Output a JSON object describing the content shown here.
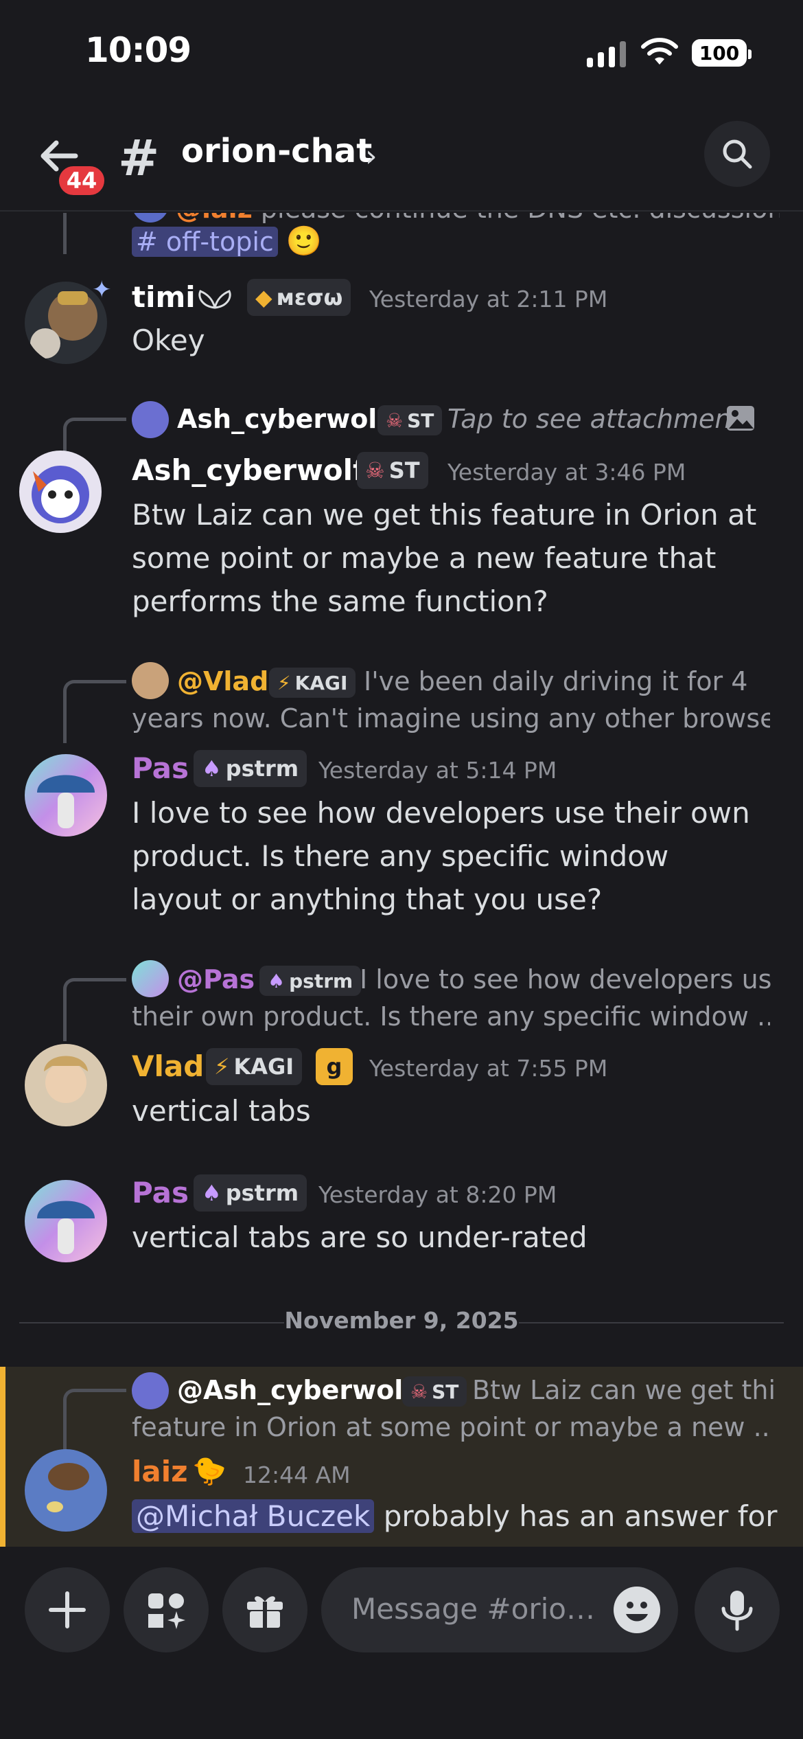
{
  "status_bar": {
    "time": "10:09",
    "battery": "100"
  },
  "header": {
    "unread_badge": "44",
    "channel_hash": "#",
    "channel_name": "orion-chat",
    "chevron": "›"
  },
  "messages": {
    "clip_top": {
      "reply_name": "@laiz",
      "reply_text": "please continue the DNS etc. discussion in",
      "channel_link": "# off-topic",
      "emoji": "🙂"
    },
    "m1": {
      "username": "timi",
      "tag": "мεσω",
      "timestamp": "Yesterday at 2:11 PM",
      "body": "Okey"
    },
    "m2": {
      "reply_name": "Ash_cyberwolf",
      "reply_tag": "ST",
      "reply_text": "Tap to see attachment",
      "username": "Ash_cyberwolf",
      "tag": "ST",
      "timestamp": "Yesterday at 3:46 PM",
      "body": "Btw Laiz can we get this feature in Orion at some point or maybe a new feature that performs the same function?"
    },
    "m3": {
      "reply_name": "@Vlad",
      "reply_tag": "KAGI",
      "reply_text_1": "I've been daily driving it for 4",
      "reply_text_2": "years now. Can't imagine using any other browser. ...",
      "username": "Pas",
      "tag": "pstrm",
      "timestamp": "Yesterday at 5:14 PM",
      "body": "I love to see how developers use their own product. Is there any specific window layout or anything that you use?"
    },
    "m4": {
      "reply_name": "@Pas",
      "reply_tag": "pstrm",
      "reply_text_1": "I love to see how developers use",
      "reply_text_2": "their own product. Is there any specific window ...",
      "username": "Vlad",
      "tag": "KAGI",
      "tag2": "g",
      "timestamp": "Yesterday at 7:55 PM",
      "body": "vertical tabs"
    },
    "m5": {
      "username": "Pas",
      "tag": "pstrm",
      "timestamp": "Yesterday at 8:20 PM",
      "body": "vertical tabs are so under-rated"
    },
    "date_divider": "November 9, 2025",
    "m6": {
      "reply_name": "@Ash_cyberwolf",
      "reply_tag": "ST",
      "reply_text_1": "Btw Laiz can we get this",
      "reply_text_2": "feature in Orion at some point or maybe a new ...",
      "username": "laiz",
      "emoji": "🐤",
      "timestamp": "12:44 AM",
      "mention": "@Michał Buczek",
      "body_rest": "probably has an answer for"
    }
  },
  "composer": {
    "placeholder": "Message #orion-..."
  },
  "colors": {
    "accent_yellow": "#f0b232",
    "pas_purple": "#b773d6",
    "laiz_orange": "#f1802f",
    "vlad_gold": "#f0b232",
    "mention_bg": "#3e4279"
  }
}
